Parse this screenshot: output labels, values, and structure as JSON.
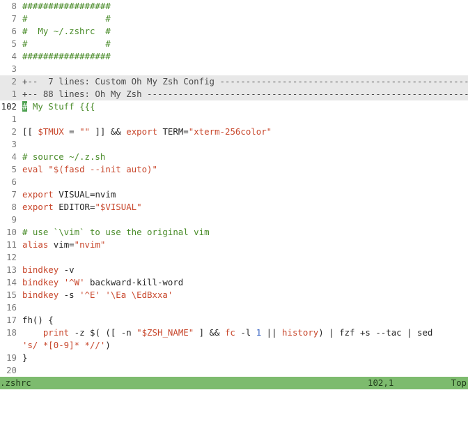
{
  "editor": {
    "lines": [
      {
        "num": "8",
        "segments": [
          {
            "t": "#################",
            "c": "comment"
          }
        ]
      },
      {
        "num": "7",
        "segments": [
          {
            "t": "#               #",
            "c": "comment"
          }
        ]
      },
      {
        "num": "6",
        "segments": [
          {
            "t": "#  My ~/.zshrc  #",
            "c": "comment"
          }
        ]
      },
      {
        "num": "5",
        "segments": [
          {
            "t": "#               #",
            "c": "comment"
          }
        ]
      },
      {
        "num": "4",
        "segments": [
          {
            "t": "#################",
            "c": "comment"
          }
        ]
      },
      {
        "num": "3",
        "segments": []
      },
      {
        "num": "2",
        "fold": true,
        "segments": [
          {
            "t": "+--  7 lines: Custom Oh My Zsh Config -----------------------------------------------------------",
            "c": "fold"
          }
        ]
      },
      {
        "num": "1",
        "fold": true,
        "segments": [
          {
            "t": "+-- 88 lines: Oh My Zsh -------------------------------------------------------------------------",
            "c": "fold"
          }
        ]
      },
      {
        "num": "102",
        "current": true,
        "segments": [
          {
            "t": "#",
            "c": "cursor"
          },
          {
            "t": " My Stuff {{{",
            "c": "comment"
          }
        ]
      },
      {
        "num": "1",
        "segments": []
      },
      {
        "num": "2",
        "segments": [
          {
            "t": "[[ ",
            "c": "plain"
          },
          {
            "t": "$TMUX",
            "c": "keyword"
          },
          {
            "t": " = ",
            "c": "plain"
          },
          {
            "t": "\"\"",
            "c": "string"
          },
          {
            "t": " ]] && ",
            "c": "plain"
          },
          {
            "t": "export",
            "c": "keyword"
          },
          {
            "t": " TERM=",
            "c": "plain"
          },
          {
            "t": "\"xterm-256color\"",
            "c": "string"
          }
        ]
      },
      {
        "num": "3",
        "segments": []
      },
      {
        "num": "4",
        "segments": [
          {
            "t": "# source ~/.z.sh",
            "c": "comment"
          }
        ]
      },
      {
        "num": "5",
        "segments": [
          {
            "t": "eval",
            "c": "keyword"
          },
          {
            "t": " ",
            "c": "plain"
          },
          {
            "t": "\"$(fasd --init auto)\"",
            "c": "string"
          }
        ]
      },
      {
        "num": "6",
        "segments": []
      },
      {
        "num": "7",
        "segments": [
          {
            "t": "export",
            "c": "keyword"
          },
          {
            "t": " VISUAL=nvim",
            "c": "plain"
          }
        ]
      },
      {
        "num": "8",
        "segments": [
          {
            "t": "export",
            "c": "keyword"
          },
          {
            "t": " EDITOR=",
            "c": "plain"
          },
          {
            "t": "\"$VISUAL\"",
            "c": "string"
          }
        ]
      },
      {
        "num": "9",
        "segments": []
      },
      {
        "num": "10",
        "segments": [
          {
            "t": "# use `\\vim` to use the original vim",
            "c": "comment"
          }
        ]
      },
      {
        "num": "11",
        "segments": [
          {
            "t": "alias",
            "c": "keyword"
          },
          {
            "t": " vim=",
            "c": "plain"
          },
          {
            "t": "\"nvim\"",
            "c": "string"
          }
        ]
      },
      {
        "num": "12",
        "segments": []
      },
      {
        "num": "13",
        "segments": [
          {
            "t": "bindkey",
            "c": "keyword"
          },
          {
            "t": " -v",
            "c": "plain"
          }
        ]
      },
      {
        "num": "14",
        "segments": [
          {
            "t": "bindkey",
            "c": "keyword"
          },
          {
            "t": " ",
            "c": "plain"
          },
          {
            "t": "'^W'",
            "c": "string"
          },
          {
            "t": " backward-kill-word",
            "c": "plain"
          }
        ]
      },
      {
        "num": "15",
        "segments": [
          {
            "t": "bindkey",
            "c": "keyword"
          },
          {
            "t": " -s ",
            "c": "plain"
          },
          {
            "t": "'^E'",
            "c": "string"
          },
          {
            "t": " ",
            "c": "plain"
          },
          {
            "t": "'\\Ea \\EdBxxa'",
            "c": "string"
          }
        ]
      },
      {
        "num": "16",
        "segments": []
      },
      {
        "num": "17",
        "segments": [
          {
            "t": "fh() {",
            "c": "plain"
          }
        ]
      },
      {
        "num": "18",
        "segments": [
          {
            "t": "    ",
            "c": "plain"
          },
          {
            "t": "print",
            "c": "keyword"
          },
          {
            "t": " -z $( ([ -n ",
            "c": "plain"
          },
          {
            "t": "\"$ZSH_NAME\"",
            "c": "string"
          },
          {
            "t": " ] && ",
            "c": "plain"
          },
          {
            "t": "fc",
            "c": "keyword"
          },
          {
            "t": " -l ",
            "c": "plain"
          },
          {
            "t": "1",
            "c": "number"
          },
          {
            "t": " || ",
            "c": "plain"
          },
          {
            "t": "history",
            "c": "keyword"
          },
          {
            "t": ") | fzf +s --tac | sed",
            "c": "plain"
          }
        ]
      },
      {
        "num": "",
        "segments": [
          {
            "t": "'s/ *[0-9]* *//'",
            "c": "string"
          },
          {
            "t": ")",
            "c": "plain"
          }
        ]
      },
      {
        "num": "19",
        "segments": [
          {
            "t": "}",
            "c": "plain"
          }
        ]
      },
      {
        "num": "20",
        "segments": []
      }
    ]
  },
  "statusline": {
    "file": ".zshrc",
    "position": "102,1",
    "percent": "Top"
  },
  "colors": {
    "comment": "#4a8c2a",
    "keyword": "#c8472c",
    "string": "#c8472c",
    "number": "#3a66c4",
    "statusline_bg": "#7dbb6e",
    "fold_bg": "#e8e8e8",
    "cursor_bg": "#4fa252"
  }
}
